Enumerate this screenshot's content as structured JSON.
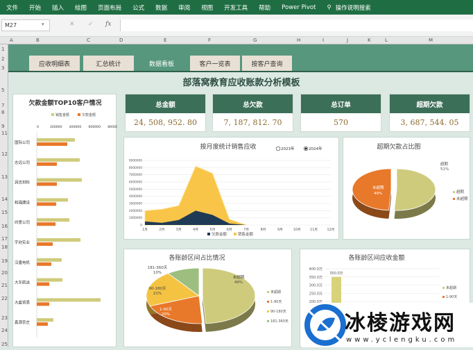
{
  "ribbon": {
    "menus": [
      "文件",
      "开始",
      "插入",
      "绘图",
      "页面布局",
      "公式",
      "数据",
      "审阅",
      "视图",
      "开发工具",
      "帮助",
      "Power Pivot"
    ],
    "search_label": "操作说明搜索",
    "search_icon": "lightbulb-icon"
  },
  "formula_bar": {
    "name_box": "M27",
    "cancel": "✕",
    "confirm": "✓",
    "fx": "fx",
    "value": ""
  },
  "columns": [
    "A",
    "B",
    "C",
    "D",
    "E",
    "F",
    "G",
    "H",
    "I",
    "J",
    "K",
    "L",
    "M"
  ],
  "rows": [
    "1",
    "2",
    "3",
    "5",
    "7",
    "8",
    "9",
    "11",
    "12",
    "13",
    "14",
    "15",
    "16",
    "17",
    "18",
    "19",
    "20",
    "21",
    "22",
    "23",
    "24",
    "25"
  ],
  "tabs": [
    {
      "label": "应收明细表"
    },
    {
      "label": "汇总统计"
    },
    {
      "label": "数据看板",
      "active": true
    },
    {
      "label": "客户一览表"
    },
    {
      "label": "按客户查询"
    }
  ],
  "title": "部落窝教育应收账款分析模板",
  "kpis": [
    {
      "label": "总金额",
      "value": "24, 508, 952. 80"
    },
    {
      "label": "总欠款",
      "value": "7, 187, 812. 70"
    },
    {
      "label": "总订单",
      "value": "570"
    },
    {
      "label": "超期欠款",
      "value": "3, 687, 544. 05"
    }
  ],
  "colors": {
    "ribbon": "#1f6e43",
    "banner": "#56977d",
    "kpi_header": "#3c6f58",
    "sales": "#cfcb7c",
    "arrears": "#e8782a",
    "area_sales": "#f8c548",
    "area_arrears": "#1f3a55",
    "yellow": "#f5c342",
    "green": "#9cbf80"
  },
  "chart_data": [
    {
      "type": "bar",
      "orientation": "horizontal",
      "title": "欠款金额TOP10客户情况",
      "categories": [
        "国际公司",
        "志远公司",
        "润吉材料",
        "和福建设",
        "欣意公司",
        "宇欣实业",
        "汉唐电机",
        "大东航运",
        "大盛贸易",
        "鑫源农庄"
      ],
      "series": [
        {
          "name": "销售金额",
          "values": [
            396000,
            447000,
            468000,
            324000,
            339000,
            454000,
            259000,
            267000,
            663000,
            173000
          ]
        },
        {
          "name": "欠款金额",
          "values": [
            317000,
            209000,
            209000,
            202000,
            195000,
            166000,
            151000,
            130000,
            130000,
            115000
          ]
        }
      ],
      "xlim": [
        0,
        800000
      ],
      "xticks": [
        "0",
        "200000",
        "400000",
        "600000",
        "800000"
      ],
      "legend": "top"
    },
    {
      "type": "area",
      "title": "按月度统计销售应收",
      "categories": [
        "1月",
        "2月",
        "3月",
        "4月",
        "5月",
        "6月",
        "7月",
        "8月",
        "9月",
        "10月",
        "11月",
        "12月"
      ],
      "series": [
        {
          "name": "欠款金额",
          "values": [
            500000,
            300000,
            700000,
            2000000,
            1400000,
            200000,
            0,
            null,
            null,
            null,
            null,
            null
          ]
        },
        {
          "name": "销售金额",
          "values": [
            2000000,
            2200000,
            2700000,
            8200000,
            7200000,
            800000,
            0,
            null,
            null,
            null,
            null,
            null
          ]
        }
      ],
      "ylim": [
        0,
        9000000
      ],
      "yticks": [
        "0",
        "1000000",
        "2000000",
        "3000000",
        "4000000",
        "5000000",
        "6000000",
        "7000000",
        "8000000",
        "9000000"
      ],
      "grid": true,
      "legend": "bottom",
      "year_options": [
        {
          "label": "2023年",
          "selected": false
        },
        {
          "label": "2024年",
          "selected": true
        }
      ]
    },
    {
      "type": "pie",
      "title": "超期欠款占比图",
      "labels": [
        "超期",
        "未超期"
      ],
      "values": [
        51,
        49
      ],
      "value_labels": [
        "51%",
        "49%"
      ],
      "legend": "right"
    },
    {
      "type": "pie",
      "title": "各账龄区间占比情况",
      "labels": [
        "未超期",
        "1-90天",
        "90-180天",
        "181-360天"
      ],
      "values": [
        49,
        20,
        21,
        10
      ],
      "value_labels": [
        "49%",
        "20%",
        "21%",
        "10%"
      ],
      "legend": "right"
    },
    {
      "type": "bar",
      "title": "各账龄区间应收金额",
      "categories": [
        "未超期"
      ],
      "values": [
        350.0
      ],
      "value_labels": [
        "350.0万"
      ],
      "yticks": [
        "400.0万",
        "350.0万",
        "300.0万",
        "250.0万",
        "200.0万"
      ],
      "ylim": [
        0,
        400
      ],
      "legend_visible": [
        "未超期",
        "1-90天"
      ],
      "legend": "right"
    }
  ],
  "watermark": {
    "text": "冰棱游戏网",
    "url": "www.yclengku.com"
  }
}
